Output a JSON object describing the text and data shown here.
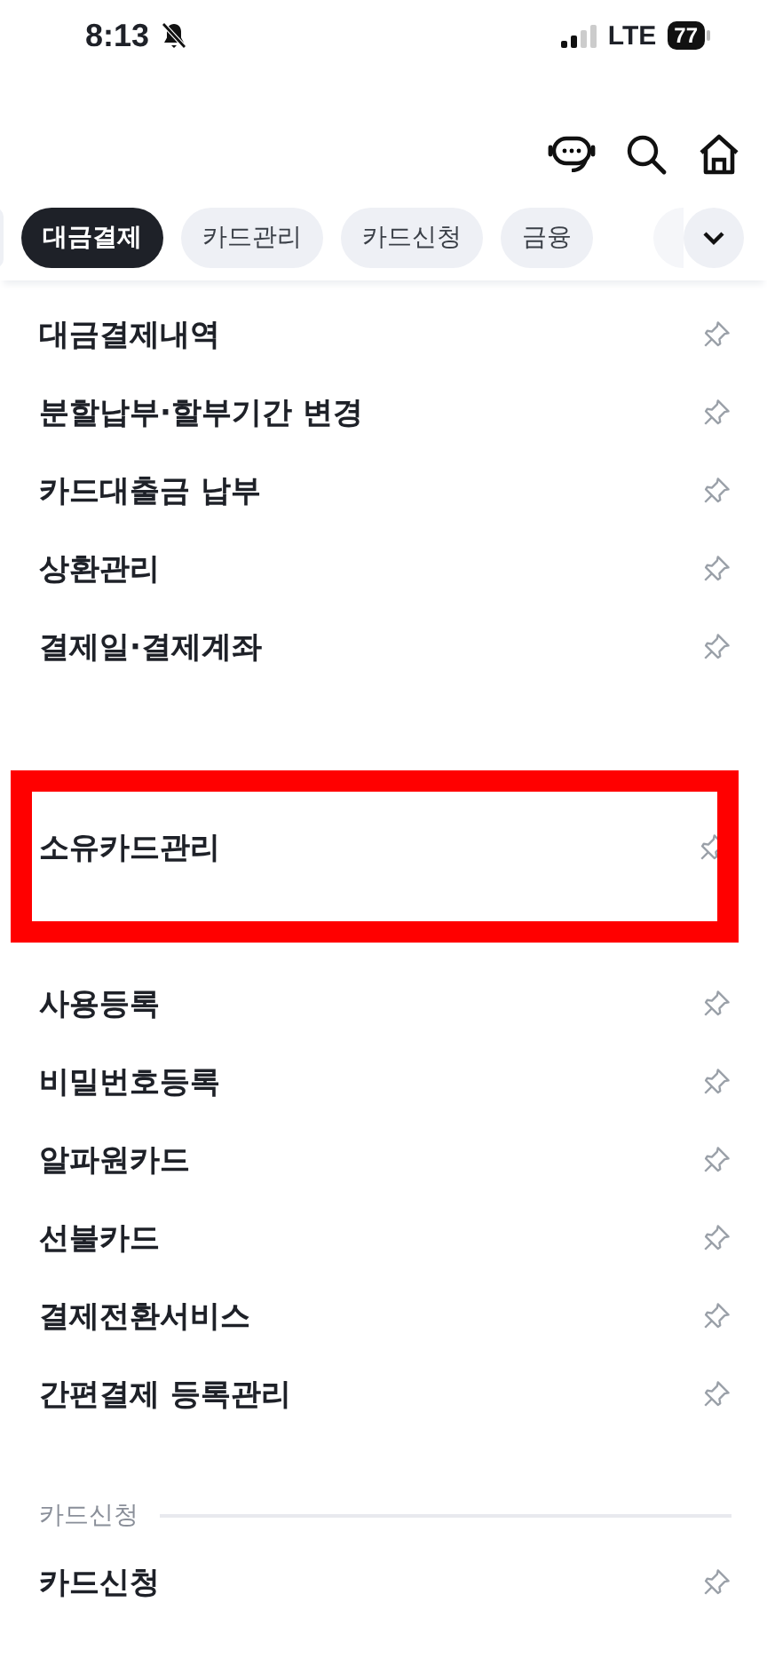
{
  "status_bar": {
    "time": "8:13",
    "network": "LTE",
    "battery": "77"
  },
  "tabs": [
    {
      "label": "대금결제",
      "selected": true
    },
    {
      "label": "카드관리",
      "selected": false
    },
    {
      "label": "카드신청",
      "selected": false
    },
    {
      "label": "금융",
      "selected": false
    }
  ],
  "sections": [
    {
      "kind": "plain",
      "items": [
        "대금결제내역",
        "분할납부·할부기간 변경",
        "카드대출금 납부",
        "상환관리",
        "결제일·결제계좌"
      ]
    },
    {
      "kind": "framed",
      "items": [
        "소유카드관리"
      ]
    },
    {
      "kind": "plain",
      "items": [
        "사용등록",
        "비밀번호등록",
        "알파원카드",
        "선불카드",
        "결제전환서비스",
        "간편결제 등록관리"
      ]
    },
    {
      "kind": "plain",
      "title": "카드신청",
      "items": [
        "카드신청"
      ]
    }
  ]
}
